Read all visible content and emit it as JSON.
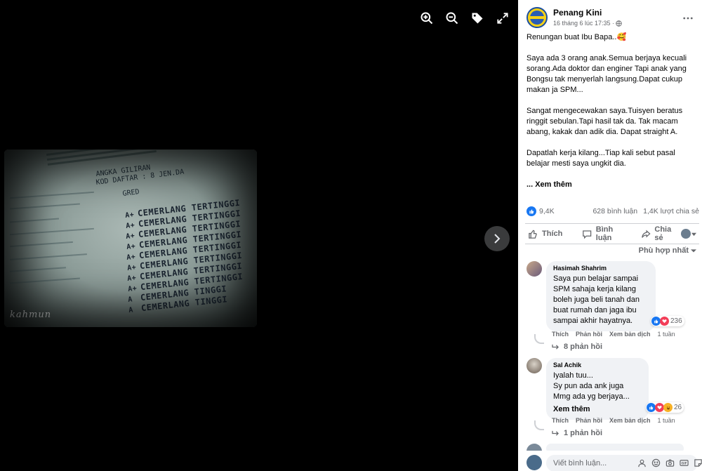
{
  "post": {
    "page_name": "Penang Kini",
    "timestamp": "16 tháng 6 lúc 17:35 ·",
    "paragraphs": [
      "Renungan buat Ibu Bapa..🥰",
      "Saya ada 3 orang anak.Semua berjaya kecuali sorang.Ada doktor dan enginer Tapi anak yang Bongsu tak menyerlah langsung.Dapat cukup makan ja SPM...",
      "Sangat mengecewakan saya.Tuisyen beratus ringgit sebulan.Tapi hasil tak da. Tak macam abang, kakak dan adik dia. Dapat straight A.",
      "Dapatlah kerja kilang...Tiap kali sebut pasal belajar mesti saya ungkit dia."
    ],
    "see_more": "... Xem thêm"
  },
  "photo": {
    "header_meta": [
      "ANGKA GILIRAN",
      "KOD DAFTAR  :  8 JEN.DA"
    ],
    "gred_label": "GRED",
    "grades": [
      {
        "grade": "A+",
        "desc": "CEMERLANG TERTINGGI"
      },
      {
        "grade": "A+",
        "desc": "CEMERLANG TERTINGGI"
      },
      {
        "grade": "A+",
        "desc": "CEMERLANG TERTINGGI"
      },
      {
        "grade": "A+",
        "desc": "CEMERLANG TERTINGGI"
      },
      {
        "grade": "A+",
        "desc": "CEMERLANG TERTINGGI"
      },
      {
        "grade": "A+",
        "desc": "CEMERLANG TERTINGGI"
      },
      {
        "grade": "A+",
        "desc": "CEMERLANG TERTINGGI"
      },
      {
        "grade": "A+",
        "desc": "CEMERLANG TERTINGGI"
      },
      {
        "grade": "A",
        "desc": "CEMERLANG TINGGI"
      },
      {
        "grade": "A",
        "desc": "CEMERLANG TINGGI"
      }
    ],
    "watermark": "kahmun"
  },
  "stats": {
    "likes": "9,4K",
    "comments": "628 bình luận",
    "shares": "1,4K lượt chia sẻ"
  },
  "actions": {
    "like": "Thích",
    "comment": "Bình luận",
    "share": "Chia sẻ"
  },
  "sort_label": "Phù hợp nhất",
  "comments": [
    {
      "name": "Hasimah Shahrim",
      "text_lines": [
        "Saya pun belajar sampai",
        "SPM sahaja kerja kilang",
        "boleh juga beli tanah dan",
        "buat rumah dan jaga ibu",
        "sampai akhir hayatnya."
      ],
      "reaction_count": "236",
      "like": "Thích",
      "reply": "Phản hồi",
      "translate": "Xem bản dịch",
      "time": "1 tuần",
      "replies": "8 phản hồi"
    },
    {
      "name": "Sal Achik",
      "text_lines": [
        "Iyalah tuu...",
        "Sy pun ada ank juga",
        "Mmg ada yg berjaya..."
      ],
      "see_more": "Xem thêm",
      "reaction_count": "26",
      "like": "Thích",
      "reply": "Phản hồi",
      "translate": "Xem bản dịch",
      "time": "1 tuần",
      "replies": "1 phản hồi"
    }
  ],
  "composer": {
    "placeholder": "Viết bình luận..."
  },
  "colors": {
    "accent": "#1877f2",
    "love": "#f33e58",
    "secondary_text": "#65676b",
    "bubble": "#f0f2f5"
  }
}
